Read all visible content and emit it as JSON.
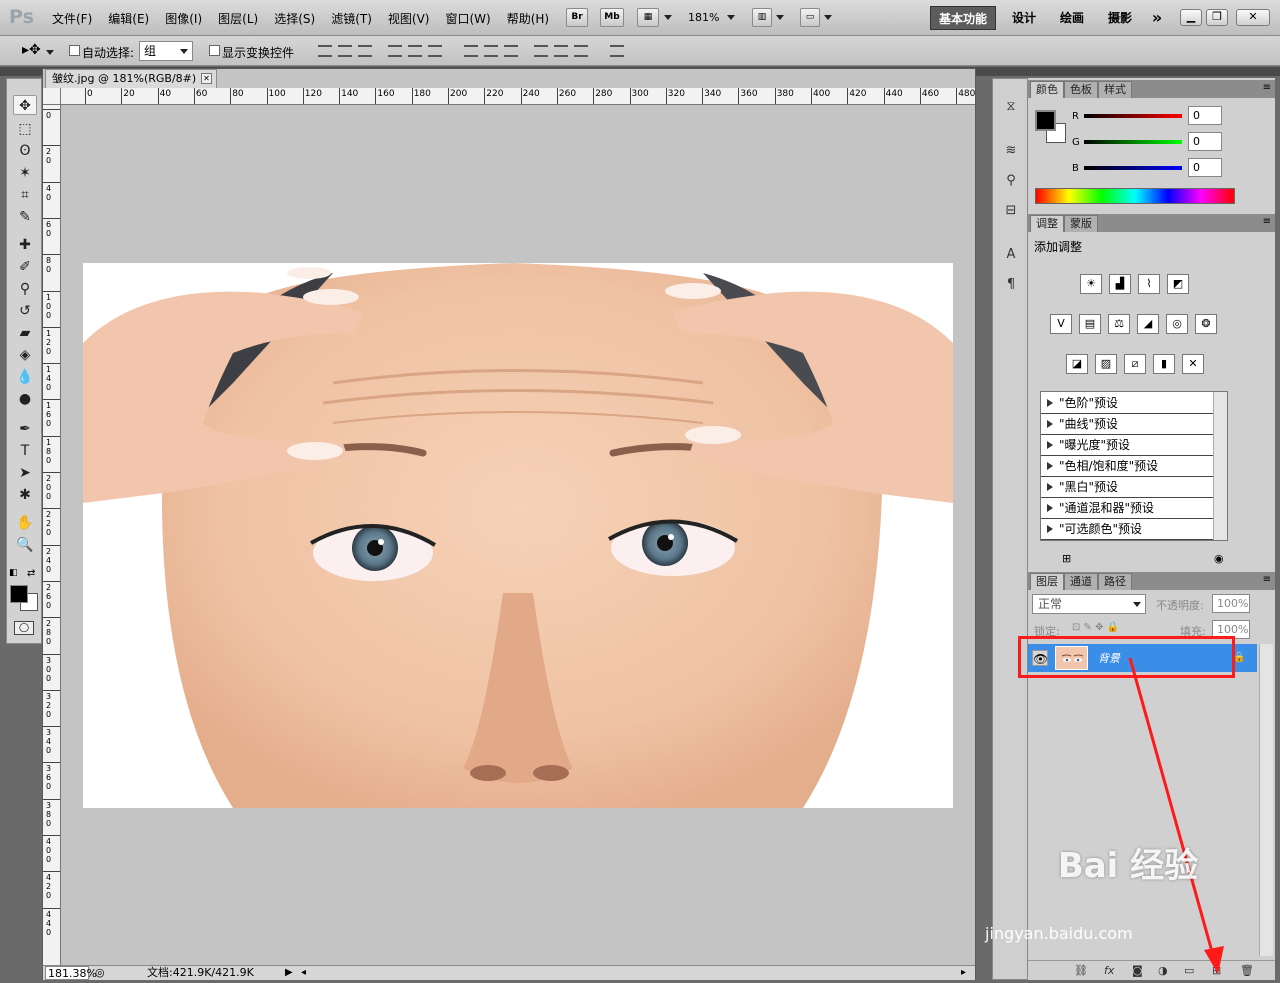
{
  "app": {
    "logo": "Ps",
    "menus": [
      "文件(F)",
      "编辑(E)",
      "图像(I)",
      "图层(L)",
      "选择(S)",
      "滤镜(T)",
      "视图(V)",
      "窗口(W)",
      "帮助(H)"
    ],
    "bridge_label": "Br",
    "minibridge_label": "Mb",
    "zoom": "181%",
    "workspaces": [
      "基本功能",
      "设计",
      "绘画",
      "摄影"
    ],
    "more": "»"
  },
  "options": {
    "auto_select_label": "自动选择:",
    "auto_select_value": "组",
    "show_transform_label": "显示变换控件"
  },
  "document": {
    "tab_title": "皱纹.jpg @ 181%(RGB/8#)",
    "tab_close": "✕",
    "ruler_h": [
      "0",
      "20",
      "40",
      "60",
      "80",
      "100",
      "120",
      "140",
      "160",
      "180",
      "200",
      "220",
      "240",
      "260",
      "280",
      "300",
      "320",
      "340",
      "360",
      "380",
      "400",
      "420",
      "440",
      "460",
      "480"
    ],
    "ruler_v": [
      "0",
      "20",
      "40",
      "60",
      "80",
      "100",
      "120",
      "140",
      "160",
      "180",
      "200",
      "220",
      "240",
      "260",
      "280",
      "300",
      "320",
      "340",
      "360",
      "380",
      "400",
      "420",
      "440"
    ],
    "status_zoom": "181.38%",
    "status_doc": "文档:421.9K/421.9K"
  },
  "color_panel": {
    "tabs": [
      "颜色",
      "色板",
      "样式"
    ],
    "r_label": "R",
    "g_label": "G",
    "b_label": "B",
    "r": "0",
    "g": "0",
    "b": "0",
    "fg": "#000000",
    "bg": "#ffffff"
  },
  "adjust_panel": {
    "tabs": [
      "调整",
      "蒙版"
    ],
    "title": "添加调整",
    "presets": [
      "\"色阶\"预设",
      "\"曲线\"预设",
      "\"曝光度\"预设",
      "\"色相/饱和度\"预设",
      "\"黑白\"预设",
      "\"通道混和器\"预设",
      "\"可选颜色\"预设"
    ]
  },
  "layers_panel": {
    "tabs": [
      "图层",
      "通道",
      "路径"
    ],
    "blend_mode": "正常",
    "opacity_label": "不透明度:",
    "opacity": "100%",
    "lock_label": "锁定:",
    "fill_label": "填充:",
    "fill": "100%",
    "layer_name": "背景"
  },
  "watermark": {
    "brand": "Bai 经验",
    "url": "jingyan.baidu.com"
  },
  "colors": {
    "selection": "#3b8ee8",
    "annotation": "#ff1a1a"
  }
}
